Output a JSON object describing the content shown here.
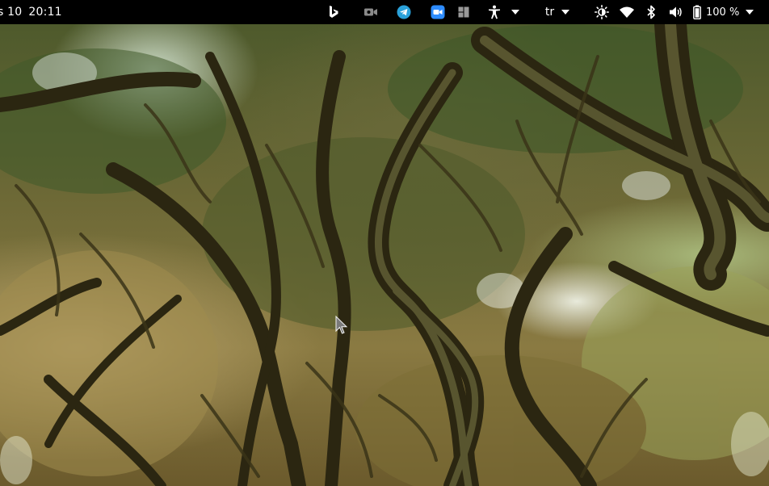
{
  "topbar": {
    "date": "s 10",
    "time": "20:11",
    "language": "tr",
    "battery_percent": "100 %"
  },
  "tray_icons": [
    "bing-icon",
    "camera-icon",
    "telegram-icon",
    "zoom-icon",
    "workspace-icon",
    "accessibility-icon",
    "chevron-down-icon",
    "brightness-icon",
    "wifi-icon",
    "bluetooth-icon",
    "volume-icon",
    "battery-icon"
  ],
  "colors": {
    "topbar_bg": "#000000",
    "telegram": "#2aa1da",
    "zoom": "#2d8cff",
    "foreground": "#ffffff"
  },
  "desktop": {
    "wallpaper": "live-oak-tree-canopy"
  }
}
